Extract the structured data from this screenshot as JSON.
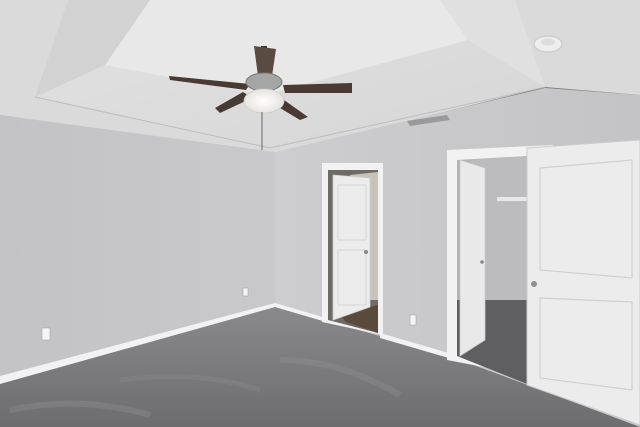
{
  "scene": {
    "subject": "empty-bedroom-interior",
    "elements": [
      "tray-ceiling",
      "ceiling-fan",
      "smoke-detector",
      "air-vent",
      "left-wall",
      "back-wall",
      "bedroom-door",
      "closet-doorway",
      "closet-door",
      "carpet-floor",
      "outlets"
    ]
  },
  "colors": {
    "wall": "#c9c9cb",
    "wall_shadow": "#b9b9bc",
    "ceiling": "#e4e4e4",
    "carpet": "#7a7a7c",
    "trim": "#f1f1f1",
    "door": "#ececec",
    "fan_blade": "#4a3a34"
  }
}
